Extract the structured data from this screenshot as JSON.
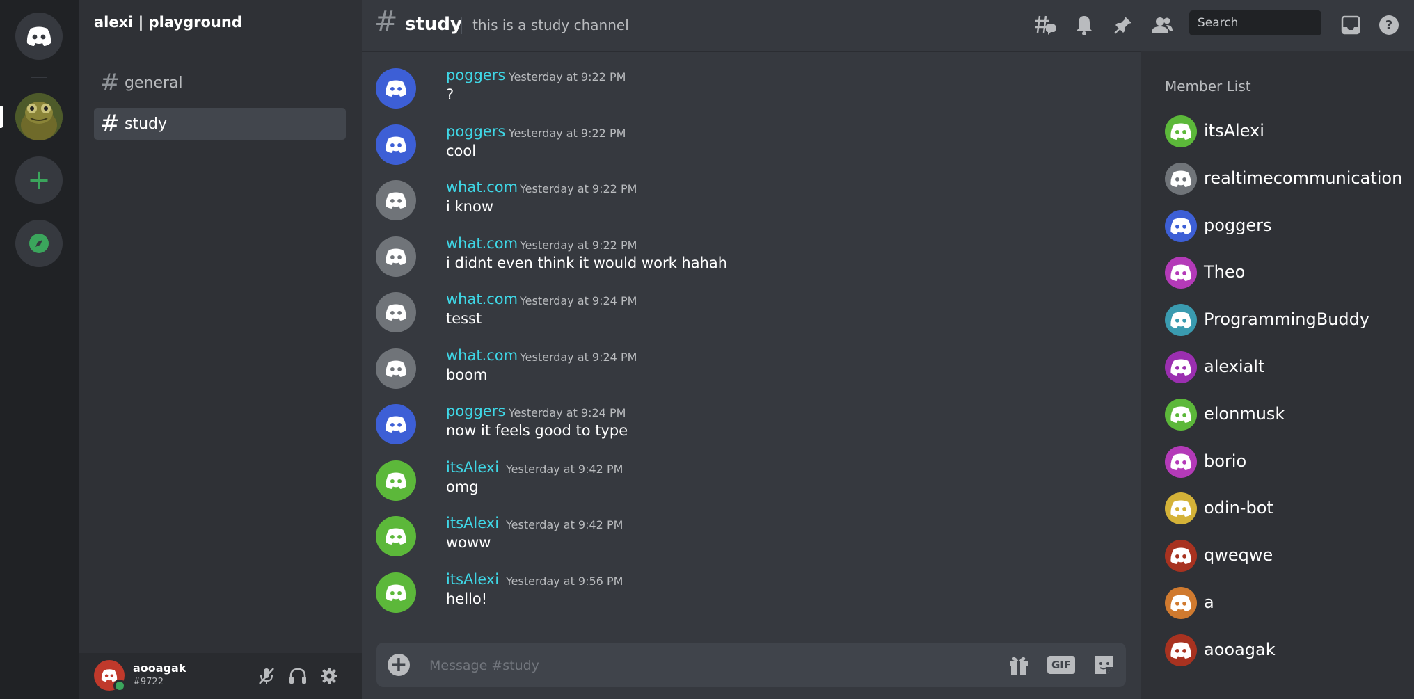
{
  "server": {
    "name": "alexi | playground",
    "channels": [
      {
        "name": "general",
        "active": false
      },
      {
        "name": "study",
        "active": true
      }
    ]
  },
  "user": {
    "name": "aooagak",
    "tag": "#9722",
    "avatar_color": "#c0392b"
  },
  "header": {
    "channel": "study",
    "topic": "this is a study channel",
    "search_placeholder": "Search"
  },
  "messages": [
    {
      "author": "poggers",
      "time": "Yesterday at 9:22 PM",
      "text": "?",
      "avatar_color": "#3d5fd6"
    },
    {
      "author": "poggers",
      "time": "Yesterday at 9:22 PM",
      "text": "cool",
      "avatar_color": "#3d5fd6"
    },
    {
      "author": "what.com",
      "time": "Yesterday at 9:22 PM",
      "text": "i know",
      "avatar_color": "#707479"
    },
    {
      "author": "what.com",
      "time": "Yesterday at 9:22 PM",
      "text": "i didnt even think it would work hahah",
      "avatar_color": "#707479"
    },
    {
      "author": "what.com",
      "time": "Yesterday at 9:24 PM",
      "text": "tesst",
      "avatar_color": "#707479"
    },
    {
      "author": "what.com",
      "time": "Yesterday at 9:24 PM",
      "text": "boom",
      "avatar_color": "#707479"
    },
    {
      "author": "poggers",
      "time": "Yesterday at 9:24 PM",
      "text": "now it feels good to type",
      "avatar_color": "#3d5fd6"
    },
    {
      "author": "itsAlexi",
      "time": "Yesterday at 9:42 PM",
      "text": "omg",
      "avatar_color": "#5cb83a"
    },
    {
      "author": "itsAlexi",
      "time": "Yesterday at 9:42 PM",
      "text": "woww",
      "avatar_color": "#5cb83a"
    },
    {
      "author": "itsAlexi",
      "time": "Yesterday at 9:56 PM",
      "text": "hello!",
      "avatar_color": "#5cb83a"
    }
  ],
  "composer": {
    "placeholder": "Message #study",
    "gif_label": "GIF"
  },
  "members": {
    "title": "Member List",
    "list": [
      {
        "name": "itsAlexi",
        "color": "#5cb83a"
      },
      {
        "name": "realtimecommunication",
        "color": "#707479"
      },
      {
        "name": "poggers",
        "color": "#3d5fd6"
      },
      {
        "name": "Theo",
        "color": "#b43ab8"
      },
      {
        "name": "ProgrammingBuddy",
        "color": "#3a9bb0"
      },
      {
        "name": "alexialt",
        "color": "#9b2fb0"
      },
      {
        "name": "elonmusk",
        "color": "#5cb83a"
      },
      {
        "name": "borio",
        "color": "#b43ab8"
      },
      {
        "name": "odin-bot",
        "color": "#d4b238"
      },
      {
        "name": "qweqwe",
        "color": "#a83220"
      },
      {
        "name": "a",
        "color": "#d07a2f"
      },
      {
        "name": "aooagak",
        "color": "#a83220"
      }
    ]
  }
}
